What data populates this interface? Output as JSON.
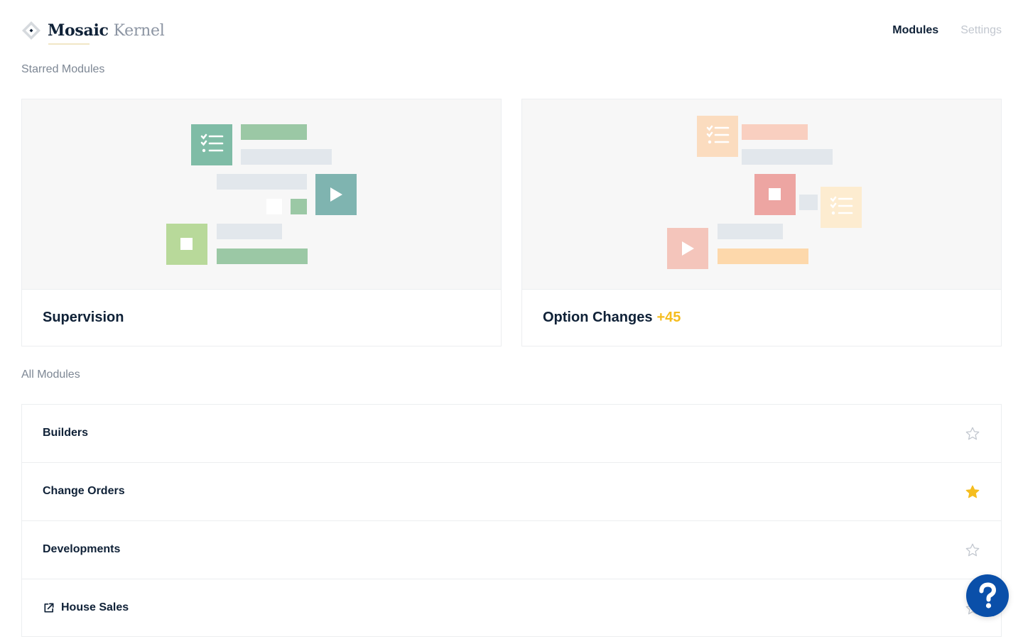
{
  "app": {
    "logo_primary": "Mosaic",
    "logo_secondary": "Kernel"
  },
  "nav": {
    "items": [
      {
        "label": "Modules",
        "active": true
      },
      {
        "label": "Settings",
        "active": false
      }
    ]
  },
  "starred": {
    "heading": "Starred Modules",
    "cards": [
      {
        "title": "Supervision",
        "badge": ""
      },
      {
        "title": "Option Changes",
        "badge": "+45"
      }
    ]
  },
  "all_modules": {
    "heading": "All Modules",
    "items": [
      {
        "label": "Builders",
        "starred": false,
        "external": false
      },
      {
        "label": "Change Orders",
        "starred": true,
        "external": false
      },
      {
        "label": "Developments",
        "starred": false,
        "external": false
      },
      {
        "label": "House Sales",
        "starred": false,
        "external": true
      }
    ]
  },
  "colors": {
    "text_primary": "#0f2137",
    "text_muted": "#7d8794",
    "star_active": "#f5bd1f",
    "star_inactive": "#c2c7cf",
    "help_button": "#0a4fa9",
    "badge": "#f5bd1f"
  },
  "icons": {
    "logo": "diamond-logo-icon",
    "external": "external-link-icon",
    "star": "star-icon",
    "help": "question-mark-icon"
  }
}
